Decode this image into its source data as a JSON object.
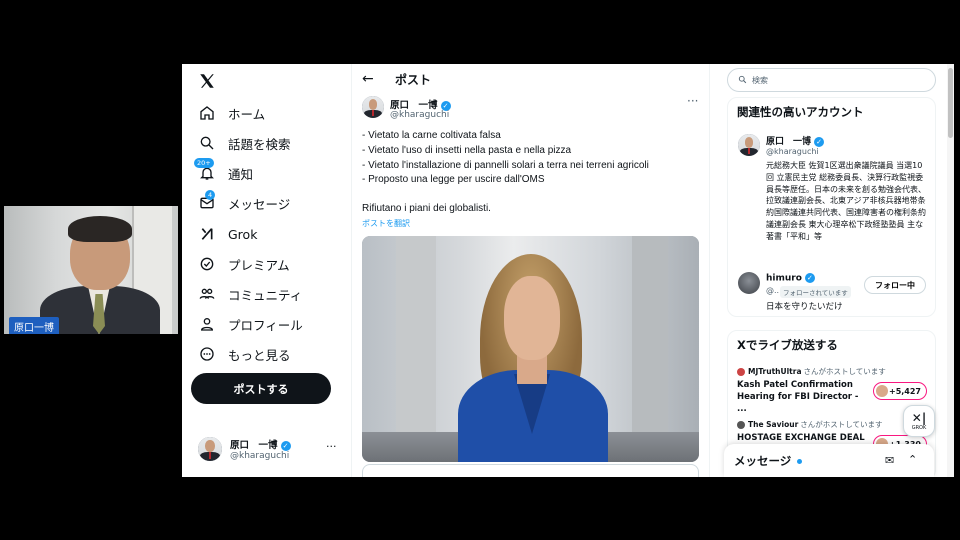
{
  "video": {
    "name": "原口一博"
  },
  "nav": {
    "items": [
      {
        "label": "ホーム"
      },
      {
        "label": "話題を検索"
      },
      {
        "label": "通知",
        "badge": "20+"
      },
      {
        "label": "メッセージ",
        "badge": "4"
      },
      {
        "label": "Grok"
      },
      {
        "label": "プレミアム"
      },
      {
        "label": "コミュニティ"
      },
      {
        "label": "プロフィール"
      },
      {
        "label": "もっと見る"
      }
    ],
    "post_button": "ポストする",
    "profile": {
      "name": "原口　一博",
      "handle": "@kharaguchi"
    }
  },
  "main": {
    "title": "ポスト",
    "author": {
      "name": "原口　一博",
      "handle": "@kharaguchi"
    },
    "post_lines": [
      "- Vietato la carne coltivata falsa",
      "- Vietato l'uso di insetti nella pasta e nella pizza",
      "- Vietato l'installazione di pannelli solari a terra nei terreni agricoli",
      "- Proposto una legge per uscire dall'OMS"
    ],
    "post_closing": "Rifiutano i piani dei globalisti.",
    "translate": "ポストを翻訳"
  },
  "right": {
    "search_placeholder": "検索",
    "related_title": "関連性の高いアカウント",
    "accounts": [
      {
        "name": "原口　一博",
        "handle": "@kharaguchi",
        "bio": "元総務大臣 佐賀1区選出衆議院議員 当選10回 立憲民主党 総務委員長、決算行政監視委員長等歴任。日本の未来を創る勉強会代表、拉致議連副会長、北東アジア非核兵器地帯条約国際議連共同代表、国連障害者の権利条約議連副会長 東大心理卒松下政経塾塾員 主な著書「平和」等"
      },
      {
        "name": "himuro",
        "handle": "@...",
        "follows_you": "フォローされています",
        "bio": "日本を守りたいだけ",
        "follow_button": "フォロー中"
      }
    ],
    "live_title": "Xでライブ放送する",
    "spaces": [
      {
        "host": "MJTruthUltra",
        "host_suffix": "さんがホストしています",
        "title": "Kash Patel Confirmation Hearing for FBI Director - ...",
        "listeners": "+5,427"
      },
      {
        "host": "The Saviour",
        "host_suffix": "さんがホストしています",
        "title": "HOSTAGE EXCHANGE DEAL",
        "listeners": "+1,330"
      }
    ],
    "grok_label": "GROK",
    "messages_title": "メッセージ"
  },
  "colors": {
    "accent": "#1d9bf0",
    "text": "#0f1419",
    "muted": "#536471",
    "live": "#f91880"
  }
}
